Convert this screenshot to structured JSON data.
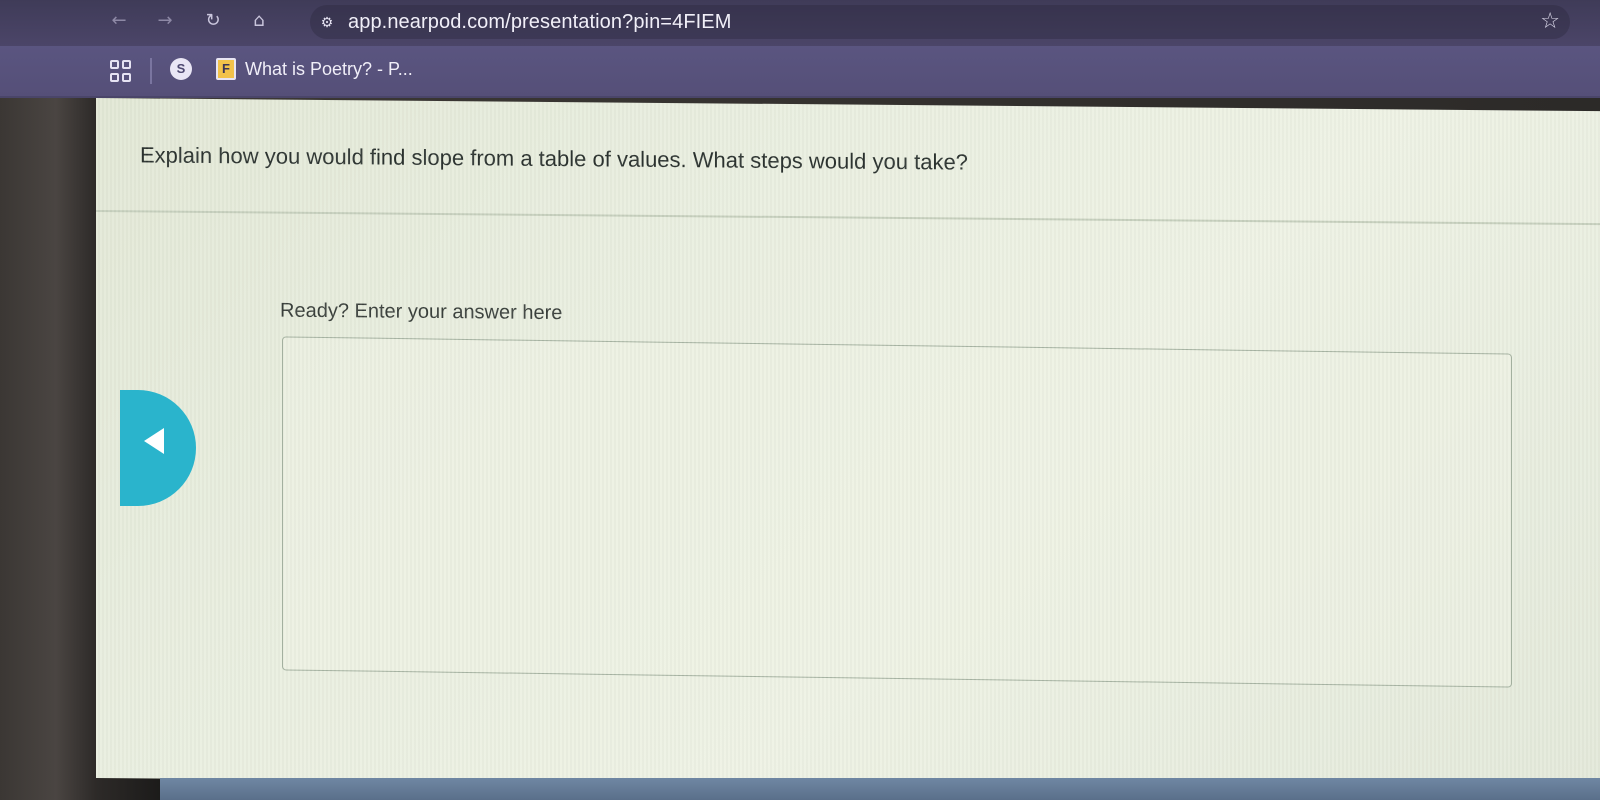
{
  "browser": {
    "url": "app.nearpod.com/presentation?pin=4FIEM",
    "bookmark_label": "What is Poetry? - P...",
    "icons": {
      "back": "arrow-left-icon",
      "forward": "arrow-right-icon",
      "reload": "reload-icon",
      "home": "home-icon",
      "site_info": "tune-icon",
      "star": "star-outline-icon",
      "apps": "apps-grid-icon"
    }
  },
  "activity": {
    "question": "Explain how you would find slope from a table of values. What steps would you take?",
    "prompt": "Ready? Enter your answer here",
    "answer_value": ""
  },
  "colors": {
    "accent": "#2ab4cc",
    "toolbar": "#4b4568",
    "bookmarks_bar": "#5a5580"
  }
}
